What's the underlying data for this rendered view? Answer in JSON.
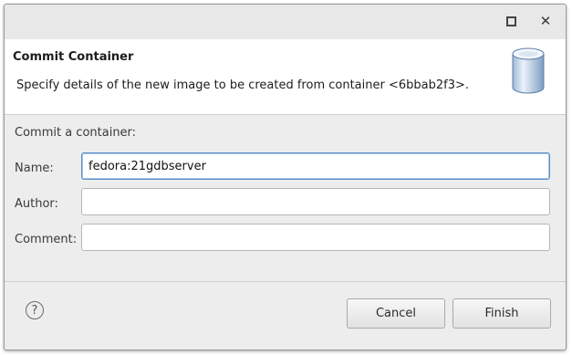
{
  "window": {
    "maximize_icon": "maximize-icon",
    "close_icon": "close-icon",
    "close_glyph": "✕"
  },
  "header": {
    "title": "Commit Container",
    "description": "Specify details of the new image to be created from container <6bbab2f3>.",
    "banner_icon": "database-cylinder-icon"
  },
  "form": {
    "section_label": "Commit a container:",
    "name_label": "Name:",
    "name_value": "fedora:21gdbserver",
    "author_label": "Author:",
    "author_value": "",
    "comment_label": "Comment:",
    "comment_value": ""
  },
  "footer": {
    "help_glyph": "?",
    "cancel_label": "Cancel",
    "finish_label": "Finish"
  },
  "colors": {
    "focus_border": "#5c8fc7",
    "dialog_bg": "#ededed",
    "header_bg": "#ffffff"
  }
}
